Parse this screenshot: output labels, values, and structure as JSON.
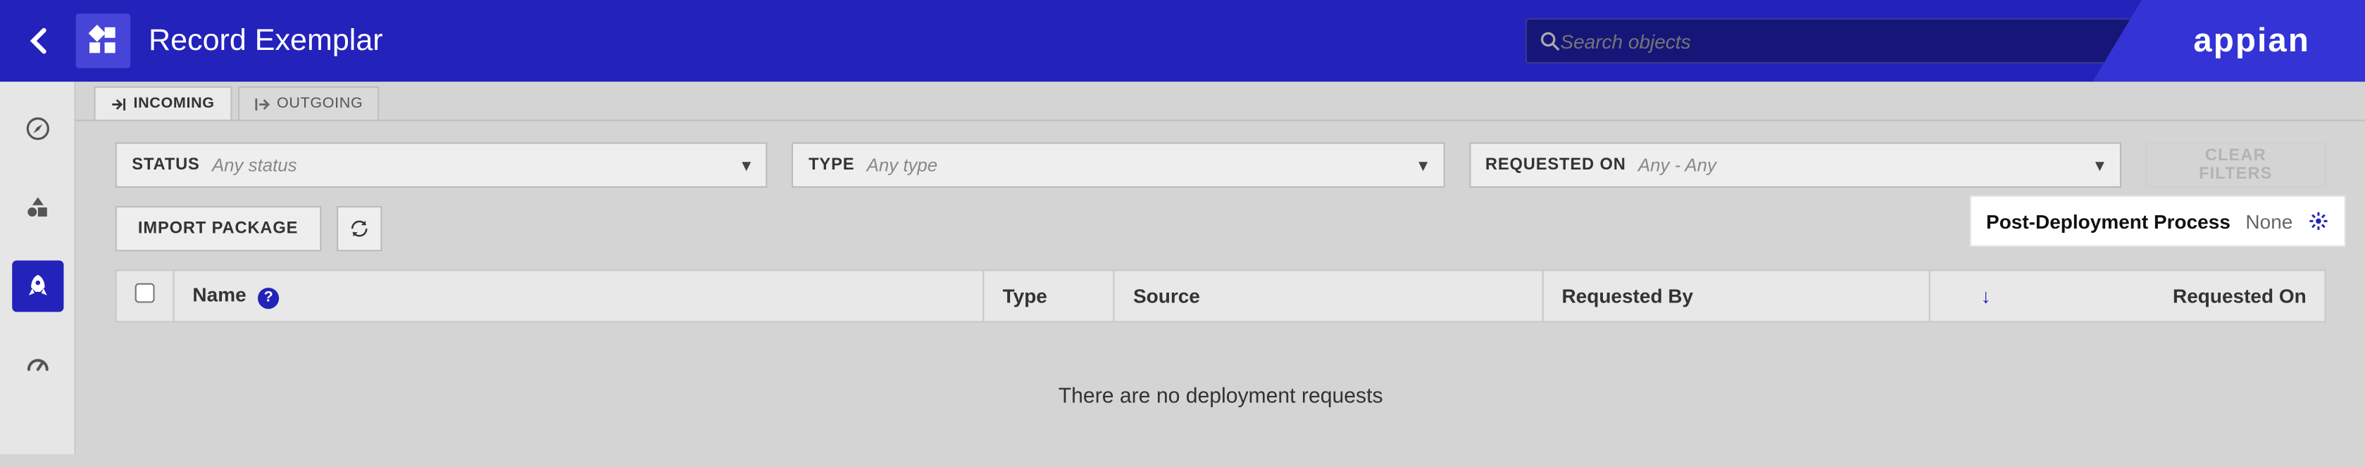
{
  "app_title": "Record Exemplar",
  "search": {
    "placeholder": "Search objects"
  },
  "logo_text": "appian",
  "tabs": {
    "incoming": "INCOMING",
    "outgoing": "OUTGOING"
  },
  "filters": {
    "status_label": "STATUS",
    "status_value": "Any status",
    "type_label": "TYPE",
    "type_value": "Any type",
    "req_label": "REQUESTED ON",
    "req_value": "Any - Any",
    "clear": "CLEAR FILTERS"
  },
  "actions": {
    "import": "IMPORT PACKAGE"
  },
  "pdp": {
    "title": "Post-Deployment Process",
    "value": "None"
  },
  "columns": {
    "name": "Name",
    "type": "Type",
    "source": "Source",
    "requested_by": "Requested By",
    "requested_on": "Requested On"
  },
  "empty_message": "There are no deployment requests"
}
